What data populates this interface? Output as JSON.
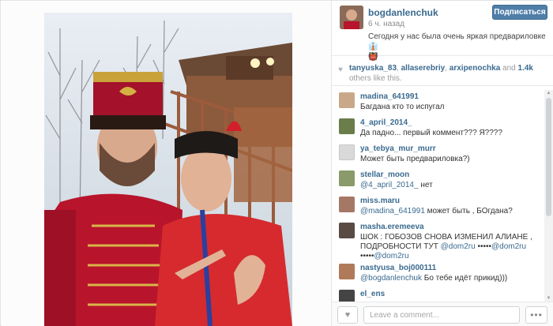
{
  "post": {
    "username": "bogdanlenchuk",
    "time_ago": "6 ч. назад",
    "caption": "Сегодня у нас была очень яркая предвариловке 👔\n👹",
    "follow_label": "Подписаться",
    "photo_icon": "photo-of-two-men-in-costumes"
  },
  "likes": {
    "icon": "heart-icon",
    "likers": [
      "tanyuska_83",
      "allaserebriy",
      "arxipenochka"
    ],
    "separator_1": ", ",
    "separator_2": ", ",
    "and_text": " and ",
    "count": "1.4k",
    "suffix": " others like this."
  },
  "comments": [
    {
      "user": "madina_641991",
      "text": "Багдана кто то испугал",
      "avatar_color": "#c9a88a"
    },
    {
      "user": "4_april_2014_",
      "text": "Да падно... первый коммент??? Я????",
      "avatar_color": "#6a7d4a"
    },
    {
      "user": "ya_tebya_mur_murr",
      "text": "Может быть предвариловка?)",
      "avatar_color": "#d9d9d9"
    },
    {
      "user": "stellar_moon",
      "mention": "@4_april_2014_",
      "text": " нет",
      "avatar_color": "#8a9a6a"
    },
    {
      "user": "miss.maru",
      "mention": "@madina_641991",
      "text": " может быть , БОгдана?",
      "avatar_color": "#a57866"
    },
    {
      "user": "masha.eremeeva",
      "text_1": "ШОК : ГОБОЗОВ СНОВА ИЗМЕНИЛ АЛИАНЕ , ПОДРОБНОСТИ ТУТ ",
      "mention_1": "@dom2ru",
      "text_2": " •••••",
      "mention_2": "@dom2ru",
      "text_3": "•••••",
      "mention_3": "@dom2ru",
      "avatar_color": "#5a4a44"
    },
    {
      "user": "nastyusa_boj000111",
      "mention": "@bogdanlenchuk",
      "text": " Бо тебе идёт прикид)))",
      "avatar_color": "#b07a5a"
    },
    {
      "user": "el_ens",
      "text": "",
      "avatar_color": "#444444"
    }
  ],
  "footer": {
    "like_icon": "heart-icon",
    "input_placeholder": "Leave a comment...",
    "more_label": "•••"
  },
  "colors": {
    "link": "#3a6a8f",
    "follow_button": "#4f7ea8"
  }
}
